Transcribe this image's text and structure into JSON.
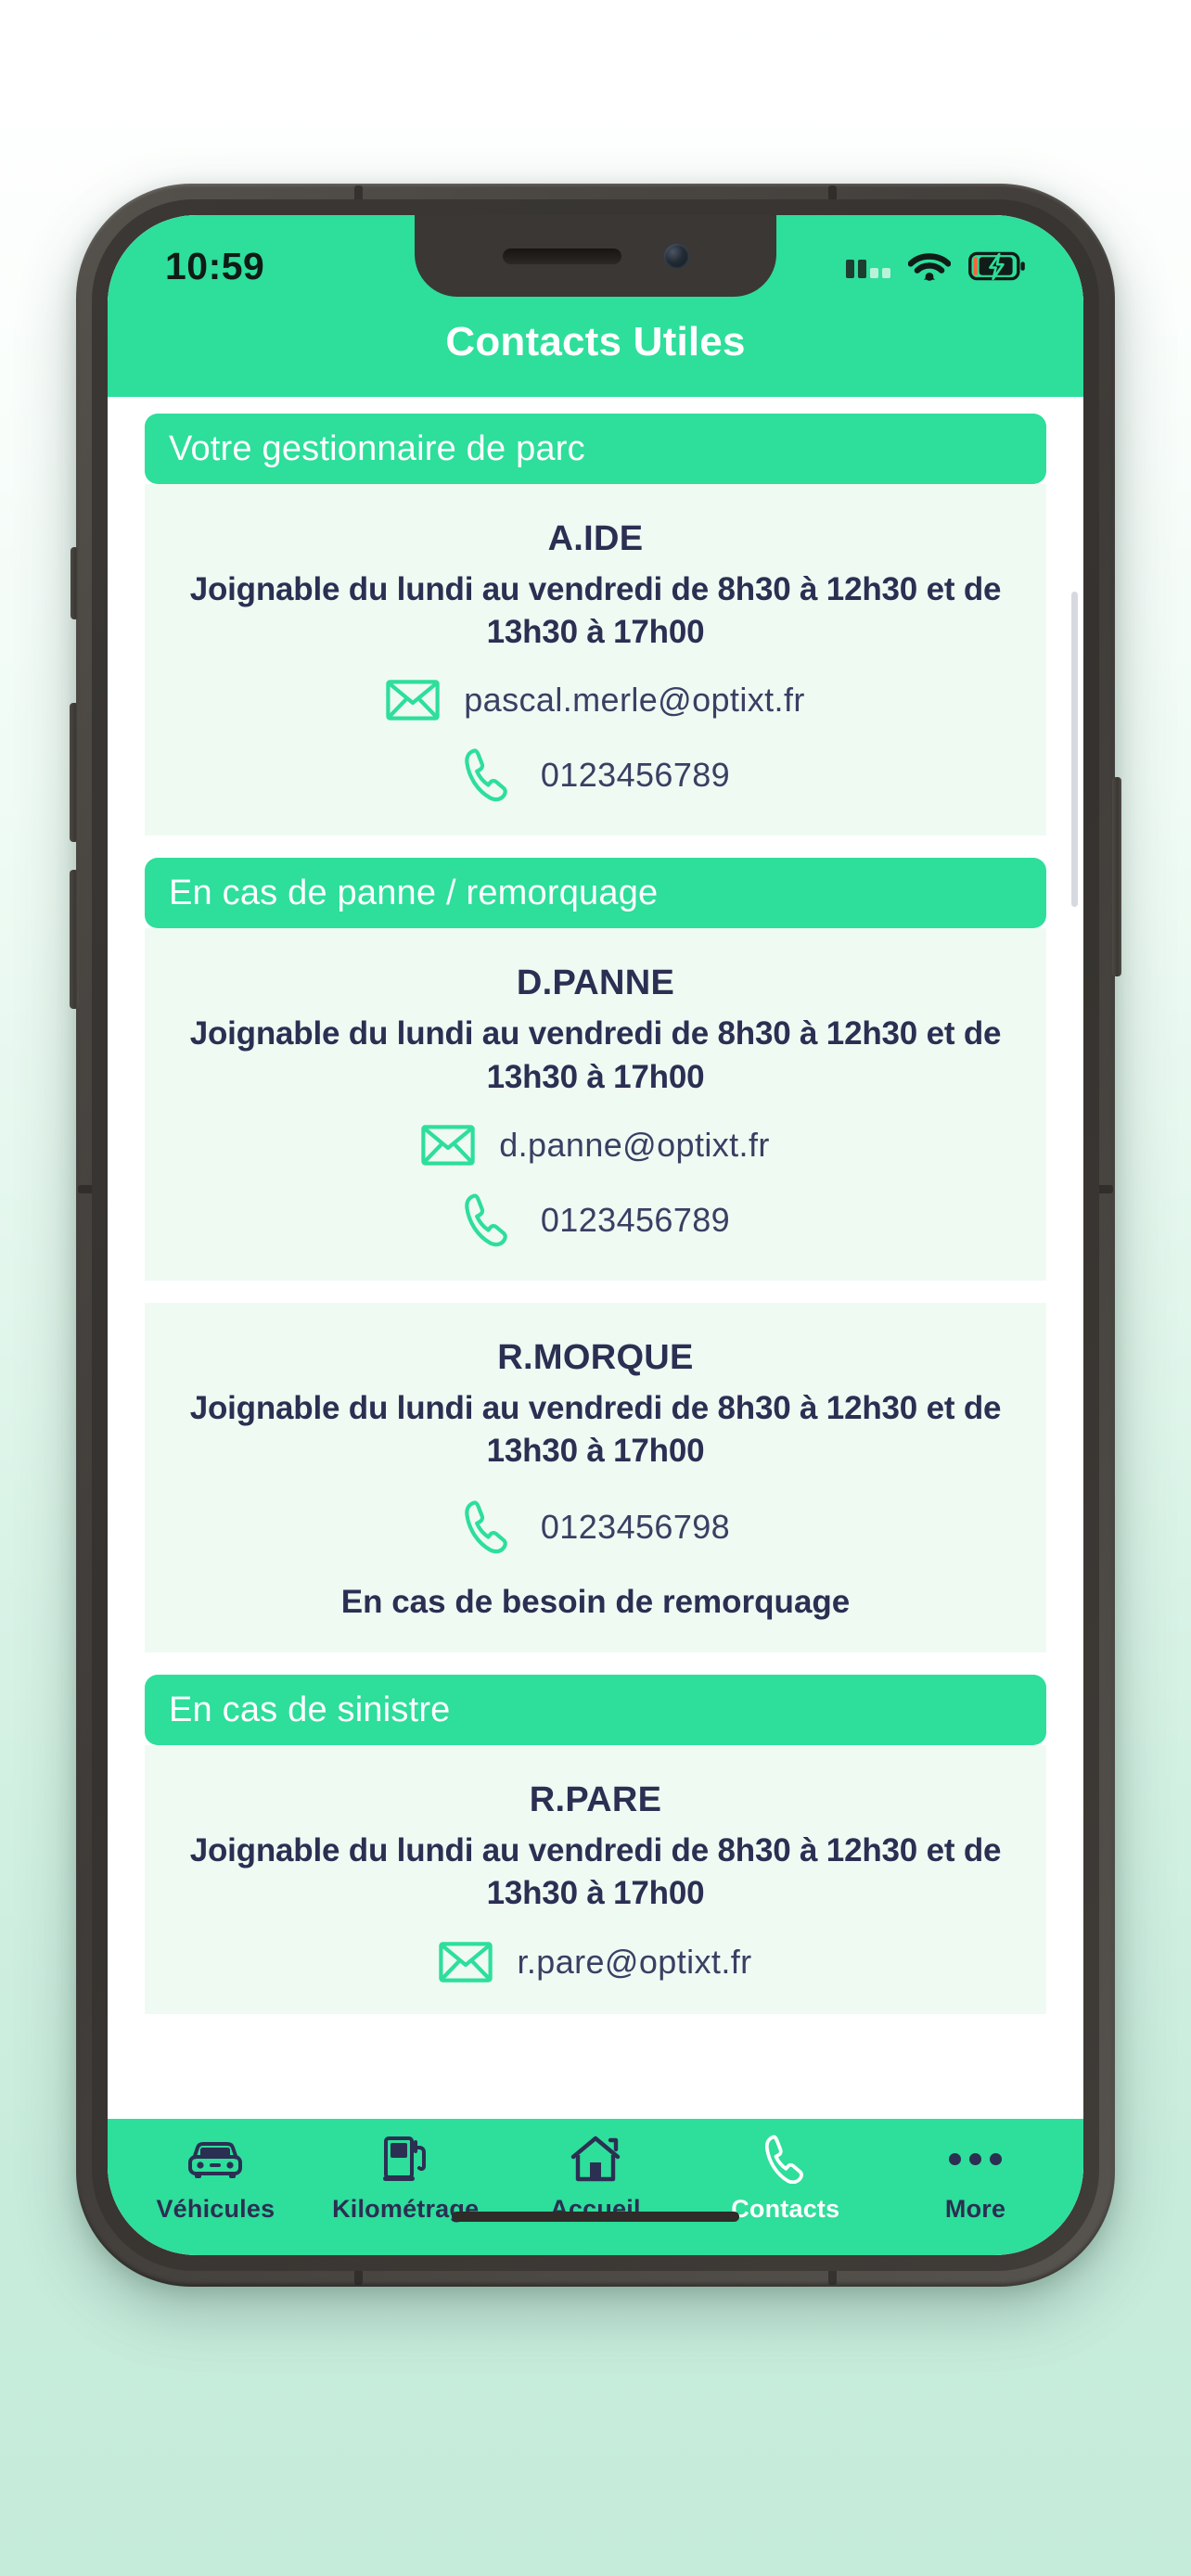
{
  "status_bar": {
    "time": "10:59",
    "signal_icon": "cellular-signal-icon",
    "wifi_icon": "wifi-icon",
    "battery_icon": "battery-charging-icon"
  },
  "header": {
    "title": "Contacts Utiles"
  },
  "colors": {
    "brand_green": "#2ede9b",
    "card_background": "#effaf3",
    "text_navy": "#2b2f52",
    "value_text": "#3a3f63",
    "white": "#ffffff"
  },
  "sections": [
    {
      "title": "Votre gestionnaire de parc",
      "cards": [
        {
          "name": "A.IDE",
          "hours": "Joignable du lundi au vendredi de 8h30 à 12h30 et de 13h30 à 17h00",
          "email": "pascal.merle@optixt.fr",
          "phone": "0123456789",
          "note": ""
        }
      ]
    },
    {
      "title": "En cas de panne / remorquage",
      "cards": [
        {
          "name": "D.PANNE",
          "hours": "Joignable du lundi au vendredi de 8h30 à 12h30 et de 13h30 à 17h00",
          "email": "d.panne@optixt.fr",
          "phone": "0123456789",
          "note": ""
        },
        {
          "name": "R.MORQUE",
          "hours": "Joignable du lundi au vendredi de 8h30 à 12h30 et de 13h30 à 17h00",
          "email": "",
          "phone": "0123456798",
          "note": "En cas de besoin de remorquage"
        }
      ]
    },
    {
      "title": "En cas de sinistre",
      "cards": [
        {
          "name": "R.PARE",
          "hours": "Joignable du lundi au vendredi de 8h30 à 12h30 et de 13h30 à 17h00",
          "email": "r.pare@optixt.fr",
          "phone": "",
          "note": ""
        }
      ]
    }
  ],
  "tab_bar": {
    "items": [
      {
        "label": "Véhicules",
        "icon": "car-icon",
        "active": false
      },
      {
        "label": "Kilométrage",
        "icon": "fuel-pump-icon",
        "active": false
      },
      {
        "label": "Accueil",
        "icon": "home-icon",
        "active": false
      },
      {
        "label": "Contacts",
        "icon": "phone-icon",
        "active": true
      },
      {
        "label": "More",
        "icon": "ellipsis-icon",
        "active": false
      }
    ]
  }
}
